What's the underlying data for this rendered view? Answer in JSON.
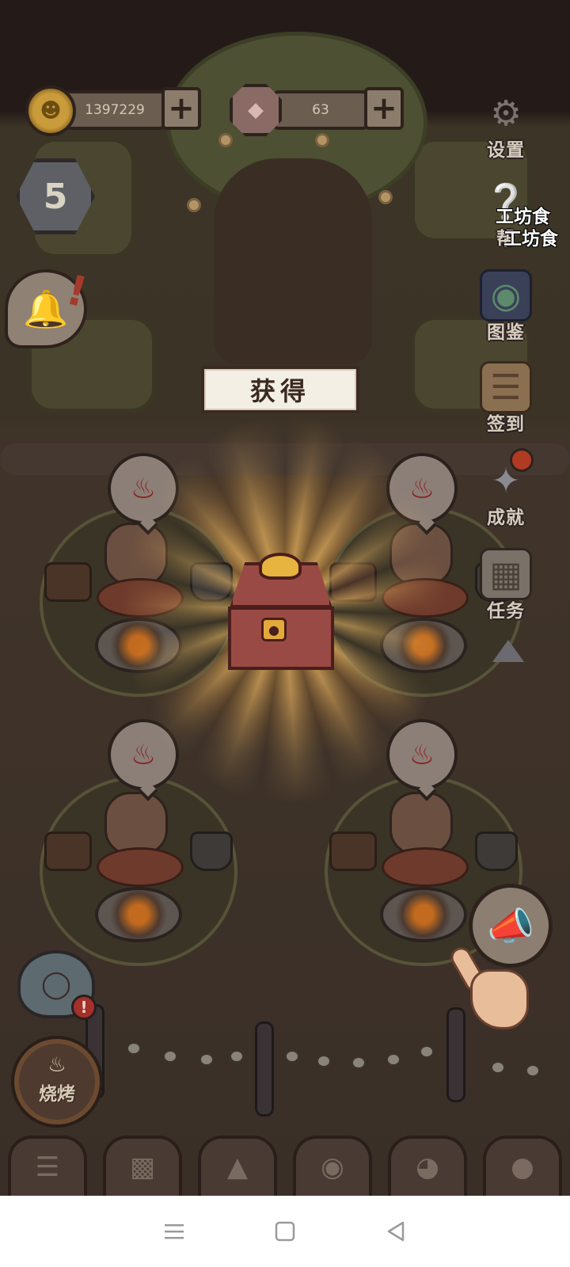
{
  "hud": {
    "coins": "1397229",
    "gems": "63",
    "plus_label": "+",
    "level": "5"
  },
  "side_menu": {
    "settings": "设置",
    "help": "帮",
    "codex": "图鉴",
    "checkin": "签到",
    "achievements": "成就",
    "tasks": "任务"
  },
  "overlay": {
    "line1": "工坊食",
    "line2": "工坊食"
  },
  "reward": {
    "title": "获得"
  },
  "bbq": {
    "label": "烧烤"
  },
  "icons": {
    "coin": "coin-icon",
    "gem": "gem-icon",
    "settings": "gear-icon",
    "help": "question-icon",
    "codex": "book-icon",
    "checkin": "scroll-icon",
    "achievements": "star-icon",
    "tasks": "map-icon",
    "horn": "megaphone-icon",
    "ghost": "ghost-icon",
    "bell": "bell-icon",
    "grill": "grill-icon"
  },
  "colors": {
    "background": "#2a1f1c",
    "accent_red": "#b03a22",
    "gold": "#e8b440",
    "label": "#d6cdbf"
  }
}
